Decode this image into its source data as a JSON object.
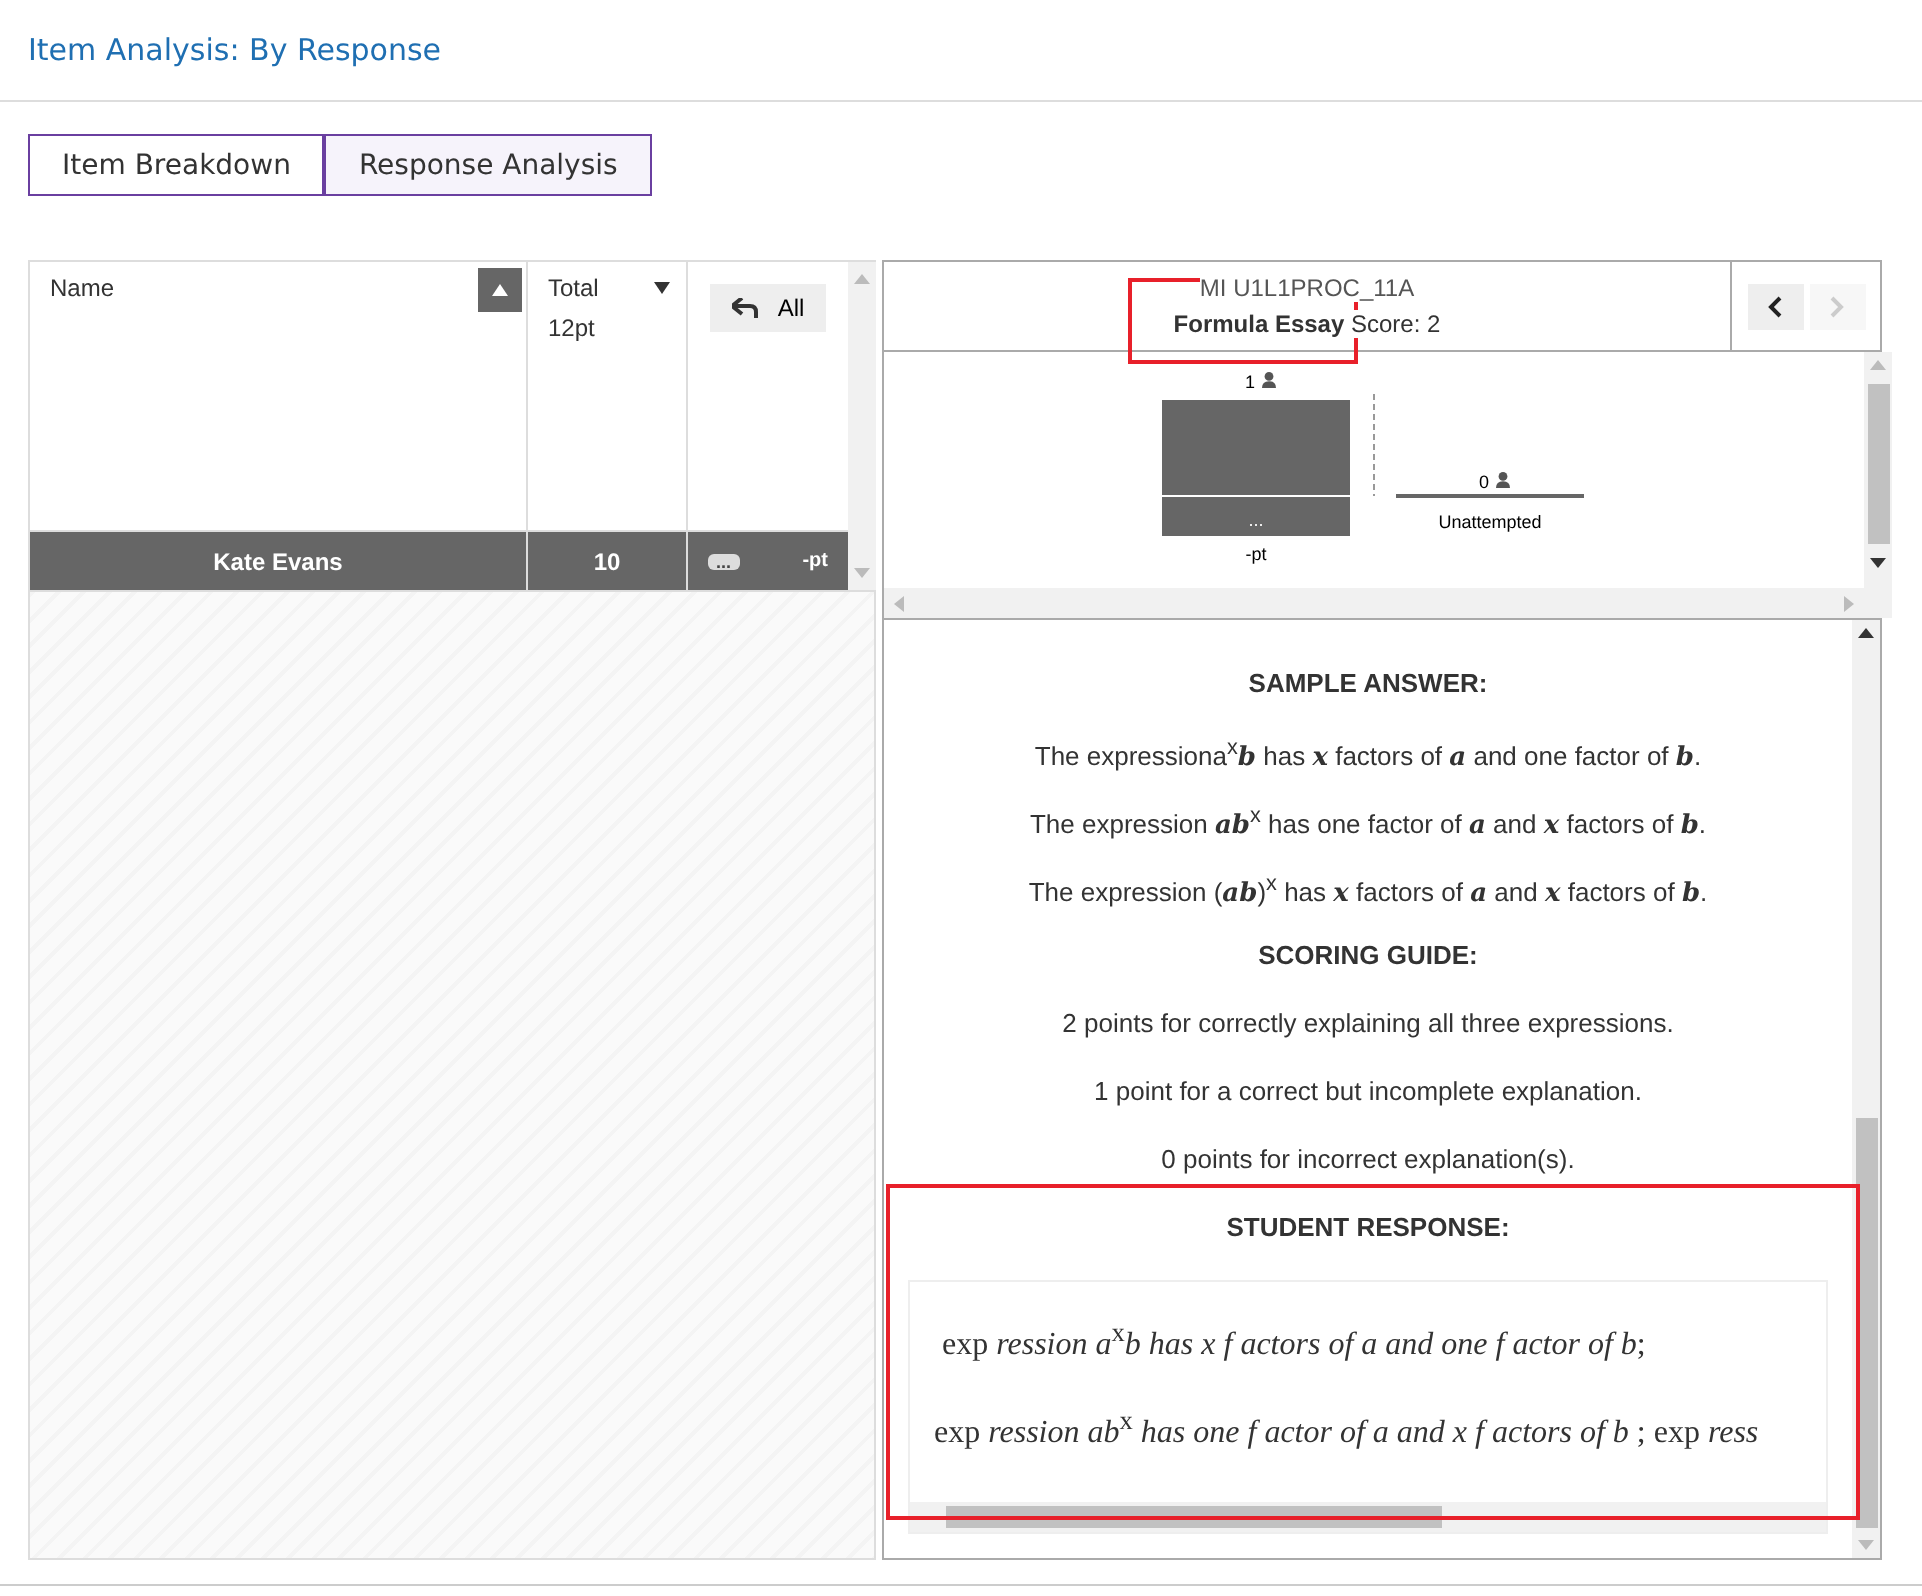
{
  "page_title": "Item Analysis: By Response",
  "view_tabs": [
    {
      "label": "Item Breakdown",
      "selected": false
    },
    {
      "label": "Response Analysis",
      "selected": true
    }
  ],
  "student_table": {
    "name_column": "Name",
    "total_column": "Total",
    "total_points": "12pt",
    "back_button": "All",
    "rows": [
      {
        "name": "Kate Evans",
        "total": "10",
        "response_chip": "...",
        "score": "-pt",
        "selected": true
      }
    ]
  },
  "item_panel": {
    "item_id": "MI U1L1PROC_11A",
    "item_type": "Formula Essay",
    "score_label": "Score: 2",
    "prev_enabled": true,
    "next_enabled": false,
    "response_groups": [
      {
        "kind": "bar",
        "count": "1",
        "inner_label": "...",
        "label": "-pt"
      },
      {
        "kind": "empty",
        "count": "0",
        "label": "Unattempted"
      }
    ]
  },
  "content": {
    "sections": [
      {
        "kind": "heading",
        "text": "SAMPLE ANSWER:"
      },
      {
        "kind": "para",
        "text": "The expressiona$^{x}$*b* has *x* factors of *a* and one factor of *b*."
      },
      {
        "kind": "para",
        "text": "The expression *ab*$^{x}$ has one factor of *a* and *x* factors of *b*."
      },
      {
        "kind": "para",
        "text": "The expression (*ab*)$^{x}$ has *x* factors of *a* and *x* factors of *b*."
      },
      {
        "kind": "heading",
        "text": "SCORING GUIDE:"
      },
      {
        "kind": "para",
        "text": "2 points for correctly explaining all three expressions."
      },
      {
        "kind": "para",
        "text": "1 point for a correct but incomplete explanation."
      },
      {
        "kind": "para",
        "text": "0 points for incorrect explanation(s)."
      },
      {
        "kind": "heading",
        "text": "STUDENT RESPONSE:"
      }
    ],
    "student_response": [
      "exp *ression a*$^{x}$*b has x f actors of a and one f actor of b*;",
      "exp *ression ab*$^{x}$ *has one f actor of a and x f actors of b* ;  exp *ress*"
    ]
  }
}
